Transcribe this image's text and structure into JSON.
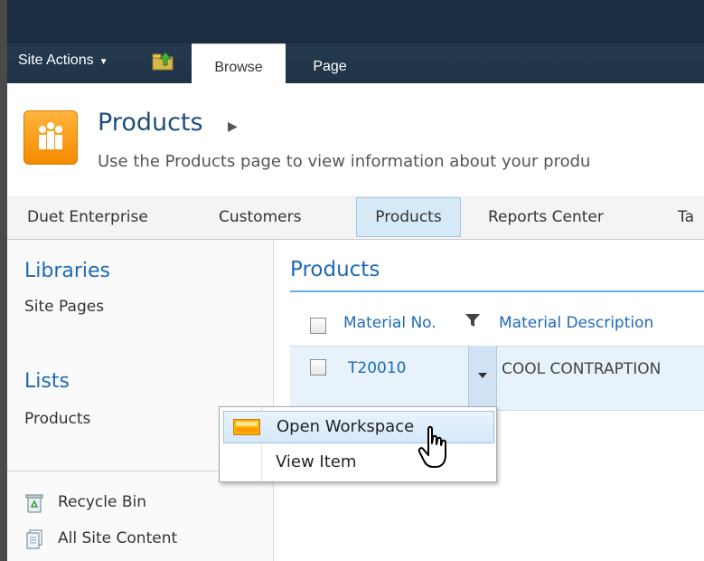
{
  "ribbon": {
    "site_actions": "Site Actions",
    "tabs": [
      "Browse",
      "Page"
    ],
    "active_tab": "Browse"
  },
  "title_area": {
    "title": "Products",
    "description": "Use the Products page to view information about your produ"
  },
  "top_nav": {
    "items": [
      "Duet Enterprise",
      "Customers",
      "Products",
      "Reports Center",
      "Ta"
    ],
    "selected": "Products"
  },
  "left_nav": {
    "libraries_heading": "Libraries",
    "libraries": [
      "Site Pages"
    ],
    "lists_heading": "Lists",
    "lists": [
      "Products"
    ],
    "recycle_bin": "Recycle Bin",
    "all_site_content": "All Site Content"
  },
  "main": {
    "title": "Products",
    "columns": [
      "Material No.",
      "Material Description"
    ],
    "rows": [
      {
        "material_no": "T20010",
        "description": "COOL CONTRAPTION"
      }
    ]
  },
  "context_menu": {
    "items": [
      "Open Workspace",
      "View Item"
    ],
    "hovered": "Open Workspace"
  },
  "colors": {
    "ribbon_dark": "#1f3448",
    "link_blue": "#1d6ab6",
    "logo_orange": "#f48a00",
    "selected_nav_bg": "#d7eaf8"
  },
  "icons": [
    "caret-down-icon",
    "navigate-up-icon",
    "site-logo-icon",
    "filter-icon",
    "recycle-bin-icon",
    "all-site-content-icon",
    "workspace-icon",
    "hand-cursor-icon"
  ]
}
